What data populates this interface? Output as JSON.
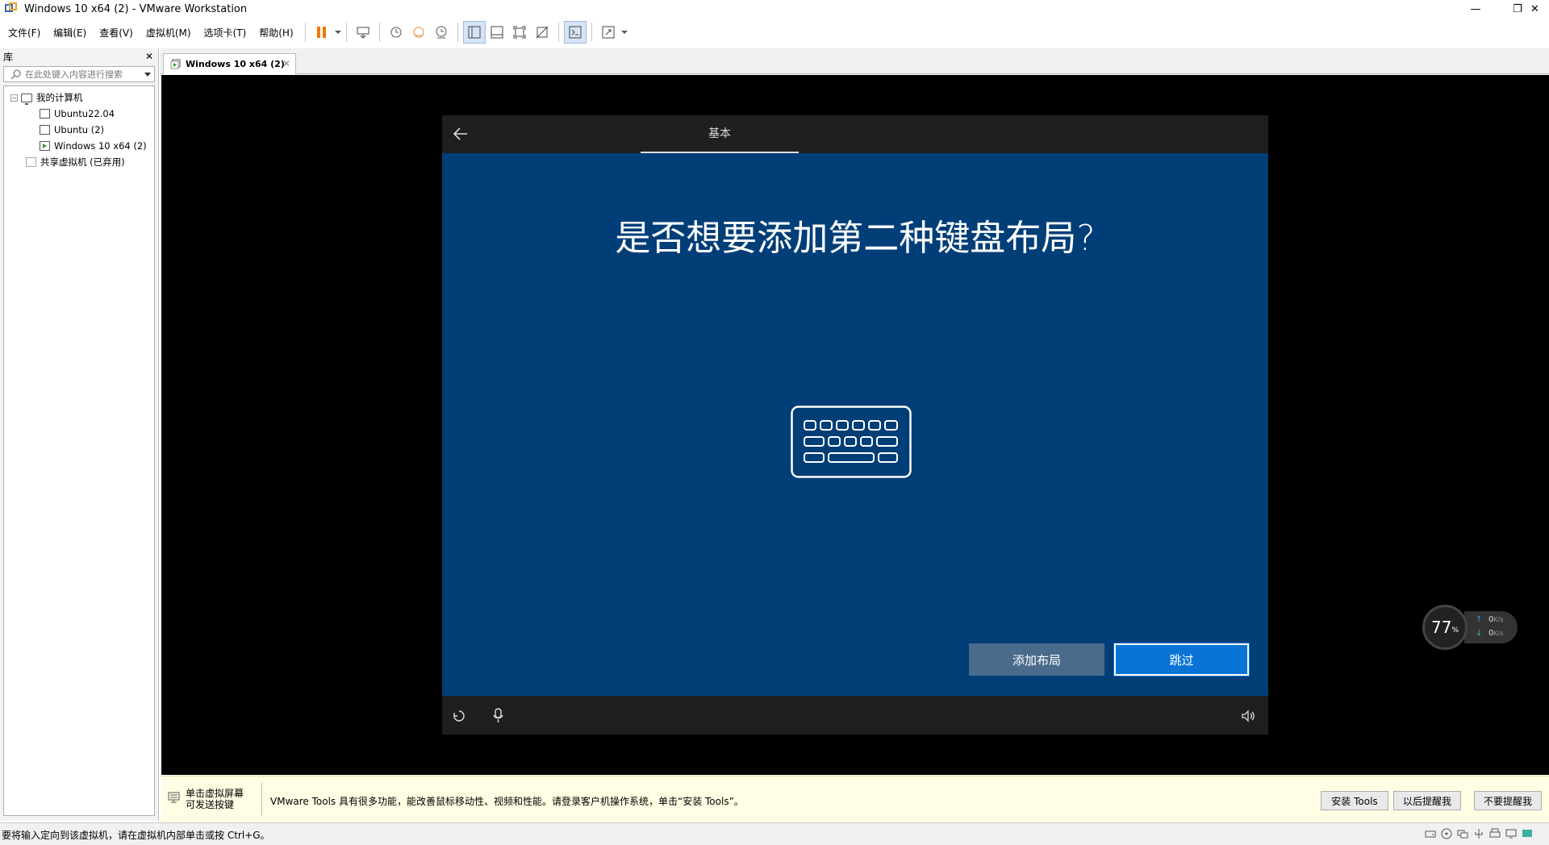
{
  "window": {
    "title": "Windows 10 x64 (2) - VMware Workstation"
  },
  "menu": {
    "file": "文件(F)",
    "edit": "编辑(E)",
    "view": "查看(V)",
    "vm": "虚拟机(M)",
    "tabs": "选项卡(T)",
    "help": "帮助(H)"
  },
  "library": {
    "title": "库",
    "search_placeholder": "在此处键入内容进行搜索",
    "tree": {
      "my_computer": "我的计算机",
      "vms": [
        "Ubuntu22.04",
        "Ubuntu (2)",
        "Windows 10 x64 (2)"
      ],
      "shared": "共享虚拟机 (已弃用)"
    }
  },
  "tab": {
    "label": "Windows 10 x64 (2)"
  },
  "oobe": {
    "section": "基本",
    "heading": "是否想要添加第二种键盘布局?",
    "add_button": "添加布局",
    "skip_button": "跳过"
  },
  "netwidget": {
    "percent": "77",
    "percent_unit": "%",
    "up": "0",
    "down": "0",
    "unit": "K/s"
  },
  "infobar": {
    "hint_line1": "单击虚拟屏幕",
    "hint_line2": "可发送按键",
    "message": "VMware Tools 具有很多功能，能改善鼠标移动性、视频和性能。请登录客户机操作系统，单击“安装 Tools”。",
    "install": "安装 Tools",
    "remind_later": "以后提醒我",
    "never_remind": "不要提醒我"
  },
  "status": {
    "text": "要将输入定向到该虚拟机，请在虚拟机内部单击或按 Ctrl+G。"
  },
  "colors": {
    "oobe_bg": "#003e78",
    "skip_btn": "#0a73d6",
    "pause": "#f07800"
  }
}
